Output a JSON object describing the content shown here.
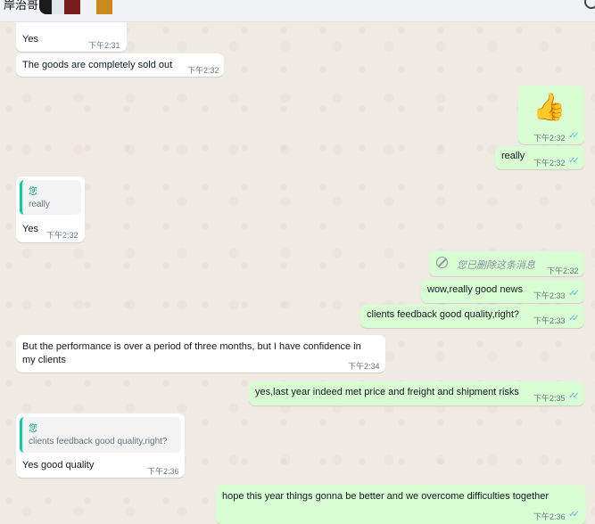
{
  "header": {
    "contact_name": "岸治哥"
  },
  "messages": [
    {
      "dir": "in",
      "text": "Yes",
      "time": "下午2:31"
    },
    {
      "dir": "in",
      "text": "The goods are completely sold out",
      "time": "下午2:32"
    },
    {
      "dir": "out",
      "emoji": "👍",
      "time": "下午2:32",
      "status": "read"
    },
    {
      "dir": "out",
      "text": "really",
      "time": "下午2:32",
      "status": "read"
    },
    {
      "dir": "in",
      "quote": {
        "author": "您",
        "text": "really"
      },
      "text": "Yes",
      "time": "下午2:32"
    },
    {
      "dir": "out",
      "deleted": true,
      "text": "您已删除这条消息",
      "time": "下午2:32"
    },
    {
      "dir": "out",
      "text": "wow,really good news",
      "time": "下午2:33",
      "status": "read"
    },
    {
      "dir": "out",
      "text": "clients feedback good quality,right?",
      "time": "下午2:33",
      "status": "read"
    },
    {
      "dir": "in",
      "text_lines": [
        "But the performance is over a period of three months, but I have confidence in",
        "my clients"
      ],
      "time": "下午2:34"
    },
    {
      "dir": "out",
      "text": "yes,last year indeed met price and freight and shipment risks",
      "time": "下午2:35",
      "status": "read"
    },
    {
      "dir": "in",
      "quote": {
        "author": "您",
        "text": "clients feedback good quality,right?"
      },
      "text": "Yes good quality",
      "time": "下午2:36"
    },
    {
      "dir": "out",
      "text": "hope this year things gonna be better and we overcome difficulties together",
      "time": "下午2:36",
      "status": "read"
    }
  ],
  "colors": {
    "incoming": "#ffffff",
    "outgoing": "#d9fdd3",
    "read_tick": "#53bdeb",
    "quote_bar": "#06cf9c"
  },
  "icons": {
    "read": "double-check-icon",
    "deleted": "ban-icon"
  },
  "tick_glyph": "✓✓"
}
